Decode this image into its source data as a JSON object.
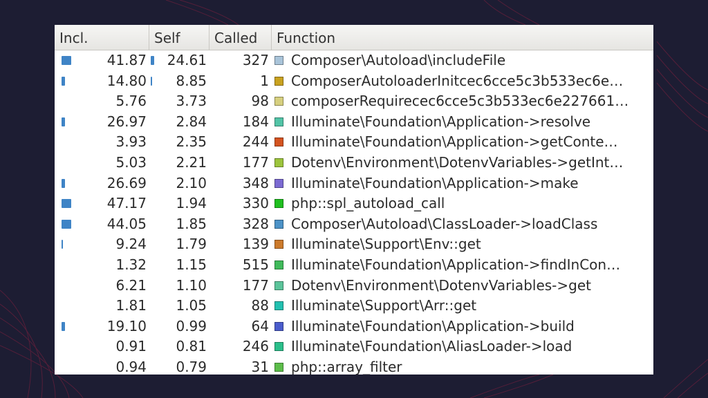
{
  "table": {
    "headers": {
      "incl": "Incl.",
      "self": "Self",
      "called": "Called",
      "function": "Function"
    },
    "rows": [
      {
        "incl": "41.87",
        "self": "24.61",
        "called": "327",
        "function": "Composer\\Autoload\\includeFile",
        "color": "#a9c4d9",
        "incl_pct": 41.87,
        "self_pct": 24.61
      },
      {
        "incl": "14.80",
        "self": "8.85",
        "called": "1",
        "function": "ComposerAutoloaderInitcec6cce5c3b533ec6e…",
        "color": "#c9a21f",
        "incl_pct": 14.8,
        "self_pct": 8.85
      },
      {
        "incl": "5.76",
        "self": "3.73",
        "called": "98",
        "function": "composerRequirecec6cce5c3b533ec6e227661…",
        "color": "#d6cf7e",
        "incl_pct": 5.76,
        "self_pct": 3.73
      },
      {
        "incl": "26.97",
        "self": "2.84",
        "called": "184",
        "function": "Illuminate\\Foundation\\Application->resolve",
        "color": "#52c4a7",
        "incl_pct": 26.97,
        "self_pct": 2.84
      },
      {
        "incl": "3.93",
        "self": "2.35",
        "called": "244",
        "function": "Illuminate\\Foundation\\Application->getConte…",
        "color": "#d4531f",
        "incl_pct": 3.93,
        "self_pct": 2.35
      },
      {
        "incl": "5.03",
        "self": "2.21",
        "called": "177",
        "function": "Dotenv\\Environment\\DotenvVariables->getInt…",
        "color": "#9cc43c",
        "incl_pct": 5.03,
        "self_pct": 2.21
      },
      {
        "incl": "26.69",
        "self": "2.10",
        "called": "348",
        "function": "Illuminate\\Foundation\\Application->make",
        "color": "#7b6ad2",
        "incl_pct": 26.69,
        "self_pct": 2.1
      },
      {
        "incl": "47.17",
        "self": "1.94",
        "called": "330",
        "function": "php::spl_autoload_call",
        "color": "#1fbf1f",
        "incl_pct": 47.17,
        "self_pct": 1.94
      },
      {
        "incl": "44.05",
        "self": "1.85",
        "called": "328",
        "function": "Composer\\Autoload\\ClassLoader->loadClass",
        "color": "#4c92c7",
        "incl_pct": 44.05,
        "self_pct": 1.85
      },
      {
        "incl": "9.24",
        "self": "1.79",
        "called": "139",
        "function": "Illuminate\\Support\\Env::get",
        "color": "#cc7a2b",
        "incl_pct": 9.24,
        "self_pct": 1.79
      },
      {
        "incl": "1.32",
        "self": "1.15",
        "called": "515",
        "function": "Illuminate\\Foundation\\Application->findInCon…",
        "color": "#3fba5a",
        "incl_pct": 1.32,
        "self_pct": 1.15
      },
      {
        "incl": "6.21",
        "self": "1.10",
        "called": "177",
        "function": "Dotenv\\Environment\\DotenvVariables->get",
        "color": "#5bc49a",
        "incl_pct": 6.21,
        "self_pct": 1.1
      },
      {
        "incl": "1.81",
        "self": "1.05",
        "called": "88",
        "function": "Illuminate\\Support\\Arr::get",
        "color": "#22c0b0",
        "incl_pct": 1.81,
        "self_pct": 1.05
      },
      {
        "incl": "19.10",
        "self": "0.99",
        "called": "64",
        "function": "Illuminate\\Foundation\\Application->build",
        "color": "#4a5ccc",
        "incl_pct": 19.1,
        "self_pct": 0.99
      },
      {
        "incl": "0.91",
        "self": "0.81",
        "called": "246",
        "function": "Illuminate\\Foundation\\AliasLoader->load",
        "color": "#2bbf8a",
        "incl_pct": 0.91,
        "self_pct": 0.81
      },
      {
        "incl": "0.94",
        "self": "0.79",
        "called": "31",
        "function": "php::array_filter",
        "color": "#5cbd4a",
        "incl_pct": 0.94,
        "self_pct": 0.79
      }
    ]
  }
}
